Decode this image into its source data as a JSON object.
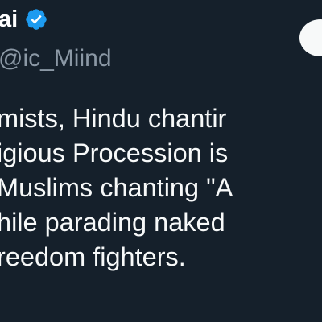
{
  "tweet": {
    "author": {
      "display_name": "ai",
      "handle": "ic_Miind",
      "verified_icon": "verified-badge-icon"
    },
    "more_button_icon": "more-options-icon",
    "body_lines": [
      "mists, Hindu chantir",
      "igious Procession is",
      "Muslims chanting \"A",
      "hile parading naked",
      "reedom fighters."
    ]
  },
  "colors": {
    "background": "#15202b",
    "text": "#f7f9f9",
    "secondary_text": "#8b98a5",
    "verified_badge": "#1d9bf0"
  }
}
